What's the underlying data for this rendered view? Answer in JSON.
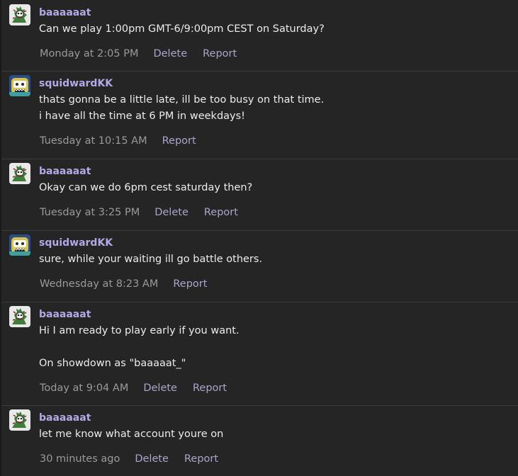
{
  "messages": [
    {
      "username": "baaaaaat",
      "avatar": "baaaaaat-avatar",
      "lines": [
        "Can we play 1:00pm GMT-6/9:00pm CEST on Saturday?"
      ],
      "time": "Monday at 2:05 PM",
      "actions": [
        "Delete",
        "Report"
      ]
    },
    {
      "username": "squidwardKK",
      "avatar": "squidwardKK-avatar",
      "lines": [
        "thats gonna be a little late, ill be too busy on that time.",
        "i have all the time at 6 PM in weekdays!"
      ],
      "time": "Tuesday at 10:15 AM",
      "actions": [
        "Report"
      ]
    },
    {
      "username": "baaaaaat",
      "avatar": "baaaaaat-avatar",
      "lines": [
        "Okay can we do 6pm cest saturday then?"
      ],
      "time": "Tuesday at 3:25 PM",
      "actions": [
        "Delete",
        "Report"
      ]
    },
    {
      "username": "squidwardKK",
      "avatar": "squidwardKK-avatar",
      "lines": [
        "sure, while your waiting ill go battle others."
      ],
      "time": "Wednesday at 8:23 AM",
      "actions": [
        "Report"
      ]
    },
    {
      "username": "baaaaaat",
      "avatar": "baaaaaat-avatar",
      "lines": [
        "Hi I am ready to play early if you want.",
        "",
        "On showdown as \"baaaaat_\""
      ],
      "time": "Today at 9:04 AM",
      "actions": [
        "Delete",
        "Report"
      ]
    },
    {
      "username": "baaaaaat",
      "avatar": "baaaaaat-avatar",
      "lines": [
        "let me know what account youre on"
      ],
      "time": "30 minutes ago",
      "actions": [
        "Delete",
        "Report"
      ]
    }
  ],
  "colors": {
    "background": "#252525",
    "username": "#b5a8e6",
    "timestamp": "#9a9a9a",
    "action_link": "#a9a6c8",
    "divider": "#3c3c3c"
  }
}
